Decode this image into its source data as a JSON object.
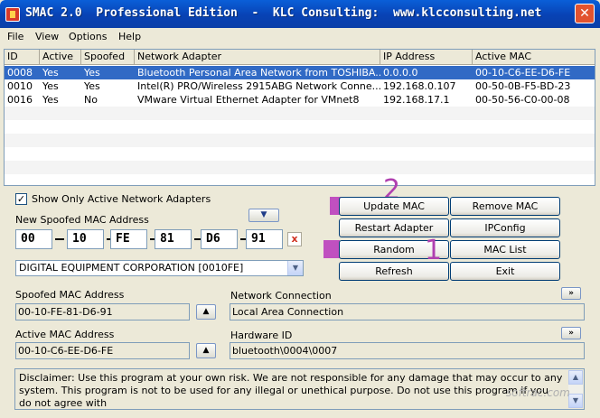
{
  "window": {
    "title": "SMAC 2.0  Professional Edition  -  KLC Consulting:  www.klcconsulting.net",
    "close_label": "✕"
  },
  "menu": [
    "File",
    "View",
    "Options",
    "Help"
  ],
  "grid": {
    "headers": [
      "ID",
      "Active",
      "Spoofed",
      "Network Adapter",
      "IP Address",
      "Active MAC"
    ],
    "rows": [
      [
        "0008",
        "Yes",
        "Yes",
        "Bluetooth Personal Area Network from TOSHIBA...",
        "0.0.0.0",
        "00-10-C6-EE-D6-FE"
      ],
      [
        "0010",
        "Yes",
        "Yes",
        "Intel(R) PRO/Wireless 2915ABG Network Conne...",
        "192.168.0.107",
        "00-50-0B-F5-BD-23"
      ],
      [
        "0016",
        "Yes",
        "No",
        "VMware Virtual Ethernet Adapter for VMnet8",
        "192.168.17.1",
        "00-50-56-C0-00-08"
      ]
    ]
  },
  "left": {
    "show_only_active_label": "Show Only Active Network Adapters",
    "show_only_active_checked": true,
    "new_mac_label": "New Spoofed MAC Address",
    "mac_octets": [
      "00",
      "10",
      "FE",
      "81",
      "D6",
      "91"
    ],
    "clear_label": "x",
    "vendor_select": "DIGITAL EQUIPMENT CORPORATION [0010FE]",
    "spoofed_mac_label": "Spoofed MAC Address",
    "spoofed_mac_value": "00-10-FE-81-D6-91",
    "active_mac_label": "Active MAC Address",
    "active_mac_value": "00-10-C6-EE-D6-FE"
  },
  "buttons": {
    "update_mac": "Update MAC",
    "remove_mac": "Remove MAC",
    "restart_adapter": "Restart Adapter",
    "ipconfig": "IPConfig",
    "random": "Random",
    "mac_list": "MAC List",
    "refresh": "Refresh",
    "exit": "Exit",
    "expand": "»"
  },
  "annotations": {
    "step1": "1",
    "step2": "2",
    "color": "#b040b0"
  },
  "right": {
    "network_connection_label": "Network Connection",
    "network_connection_value": "Local Area Connection",
    "hardware_id_label": "Hardware ID",
    "hardware_id_value": "bluetooth\\0004\\0007"
  },
  "disclaimer": "Disclaimer: Use this program at your own risk.  We are not responsible for any damage that may occur to any system. This program is not to be used for any illegal or unethical purpose.  Do not use this program if you do not agree with",
  "watermark": "softrac.com"
}
